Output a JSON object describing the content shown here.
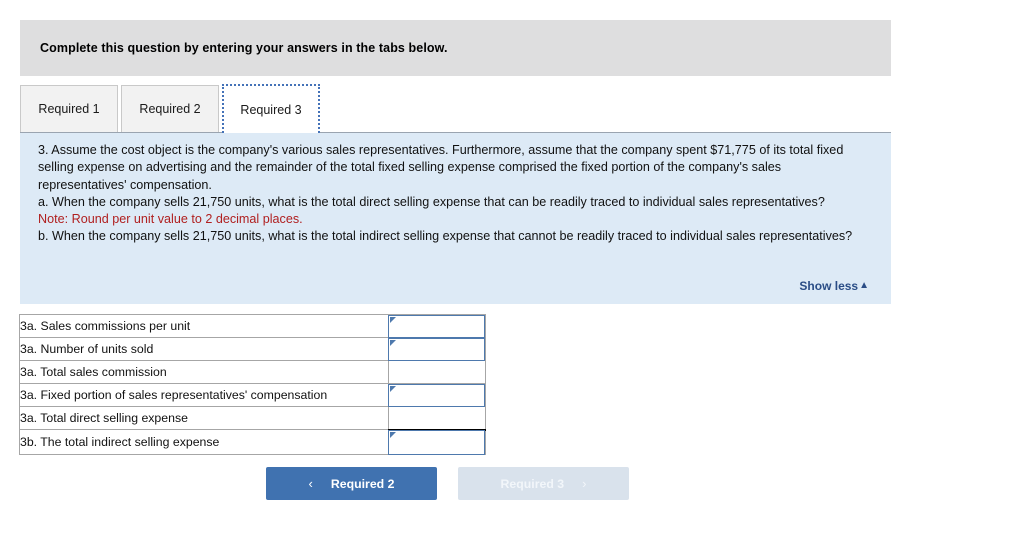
{
  "banner": {
    "instruction": "Complete this question by entering your answers in the tabs below."
  },
  "tabs": [
    {
      "label": "Required 1",
      "active": false
    },
    {
      "label": "Required 2",
      "active": false
    },
    {
      "label": "Required 3",
      "active": true
    }
  ],
  "question": {
    "paragraph": "3. Assume the cost object is the company's various sales representatives. Furthermore, assume that the company spent $71,775 of its total fixed selling expense on advertising and the remainder of the total fixed selling expense comprised the fixed portion of the company's sales representatives' compensation.",
    "part_a": "a. When the company sells 21,750 units, what is the total direct selling expense that can be readily traced to individual sales representatives?",
    "note": "Note: Round per unit value to 2 decimal places.",
    "part_b": "b. When the company sells 21,750 units, what is the total indirect selling expense that cannot be readily traced to individual sales representatives?",
    "show_less_label": "Show less",
    "show_less_caret": "▲"
  },
  "answer_table": {
    "rows": [
      {
        "label": "3a. Sales commissions per unit",
        "value": "",
        "input": true,
        "computed": false
      },
      {
        "label": "3a. Number of units sold",
        "value": "",
        "input": true,
        "computed": false
      },
      {
        "label": "3a. Total sales commission",
        "value": "",
        "input": false,
        "computed": false
      },
      {
        "label": "3a. Fixed portion of sales representatives' compensation",
        "value": "",
        "input": true,
        "computed": false
      },
      {
        "label": "3a. Total direct selling expense",
        "value": "",
        "input": false,
        "computed": true
      },
      {
        "label": "3b. The total indirect selling expense",
        "value": "",
        "input": true,
        "computed": false
      }
    ]
  },
  "navigation": {
    "prev_label": "Required 2",
    "prev_chevron": "‹",
    "next_label": "Required 3",
    "next_chevron": "›"
  },
  "colors": {
    "banner_bg": "#dededf",
    "panel_bg": "#ddeaf6",
    "note_red": "#b02020",
    "link_blue": "#2a4d86",
    "accent_blue": "#4072b0",
    "input_border": "#4e79ad",
    "disabled_bg": "#d9e2ec"
  }
}
